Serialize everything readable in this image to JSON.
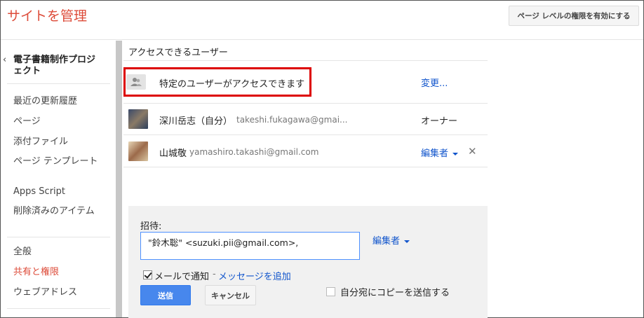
{
  "header": {
    "title": "サイトを管理",
    "page_level_button": "ページ レベルの権限を有効にする"
  },
  "sidebar": {
    "back_label": "電子書籍制作プロジェクト",
    "items": [
      {
        "label": "最近の更新履歴"
      },
      {
        "label": "ページ"
      },
      {
        "label": "添付ファイル"
      },
      {
        "label": "ページ テンプレート"
      },
      {
        "label": "Apps Script"
      },
      {
        "label": "削除済みのアイテム"
      },
      {
        "label": "全般"
      },
      {
        "label": "共有と権限"
      },
      {
        "label": "ウェブアドレス"
      }
    ],
    "active_item": "共有と権限"
  },
  "main": {
    "section_title": "アクセスできるユーザー",
    "access": {
      "text": "特定のユーザーがアクセスできます",
      "change_link": "変更..."
    },
    "users": [
      {
        "name": "深川岳志（自分）",
        "email": "takeshi.fukagawa@gmai...",
        "role": "オーナー"
      },
      {
        "name": "山城敬",
        "email": "yamashiro.takashi@gmail.com",
        "role": "編集者"
      }
    ],
    "remove_symbol": "✕"
  },
  "invite": {
    "label": "招待:",
    "input_value": "\"鈴木聡\" <suzuki.pii@gmail.com>,",
    "role": "編集者",
    "notify_label": "メールで通知",
    "separator": "-",
    "add_message": "メッセージを追加",
    "send_button": "送信",
    "cancel_button": "キャンセル",
    "copy_label": "自分宛にコピーを送信する",
    "notify_checked": true,
    "copy_checked": false
  },
  "colors": {
    "accent_red": "#dd4b39",
    "link_blue": "#1155cc",
    "primary_button": "#4787ed",
    "highlight_border": "#dd0000"
  },
  "icons": {
    "back": "chevron-left-icon",
    "access": "people-icon",
    "dropdown": "caret-down-icon",
    "remove": "close-icon"
  }
}
